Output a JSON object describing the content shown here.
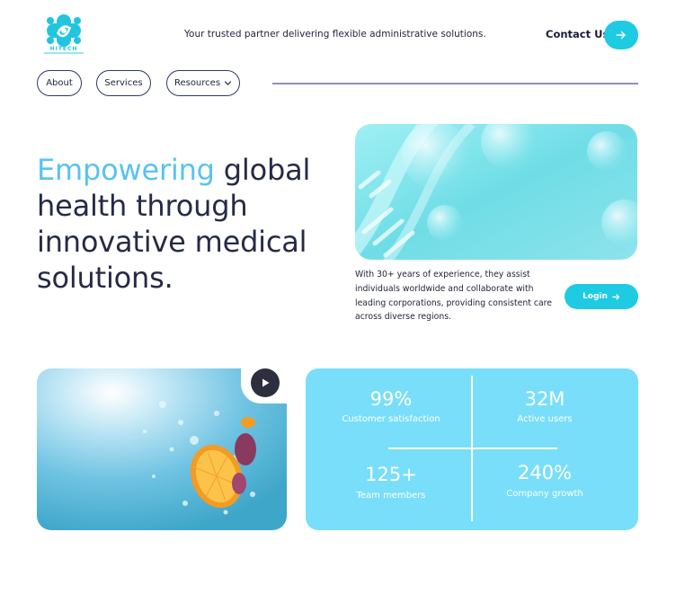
{
  "brand": {
    "logo_text": "HITECH",
    "accent": "#1fcbe3",
    "highlight": "#58c3ef"
  },
  "header": {
    "tagline": "Your trusted partner delivering flexible administrative solutions.",
    "contact_label": "Contact Us",
    "contact_icon": "arrow-right-icon"
  },
  "nav": {
    "items": [
      {
        "label": "About"
      },
      {
        "label": "Services"
      },
      {
        "label": "Resources",
        "icon": "chevron-down-icon"
      }
    ]
  },
  "hero": {
    "title_highlight": "Empowering",
    "title_rest": "global health through innovative medical solutions.",
    "description": "With 30+ years of experience, they assist individuals worldwide and collaborate with leading corporations, providing consistent care across diverse regions.",
    "login_label": "Login",
    "login_icon": "arrow-right-icon"
  },
  "media": {
    "play_icon": "play-icon"
  },
  "stats": [
    {
      "value": "99%",
      "label": "Customer satisfaction"
    },
    {
      "value": "32M",
      "label": "Active users"
    },
    {
      "value": "125+",
      "label": "Team members"
    },
    {
      "value": "240%",
      "label": "Company growth"
    }
  ]
}
